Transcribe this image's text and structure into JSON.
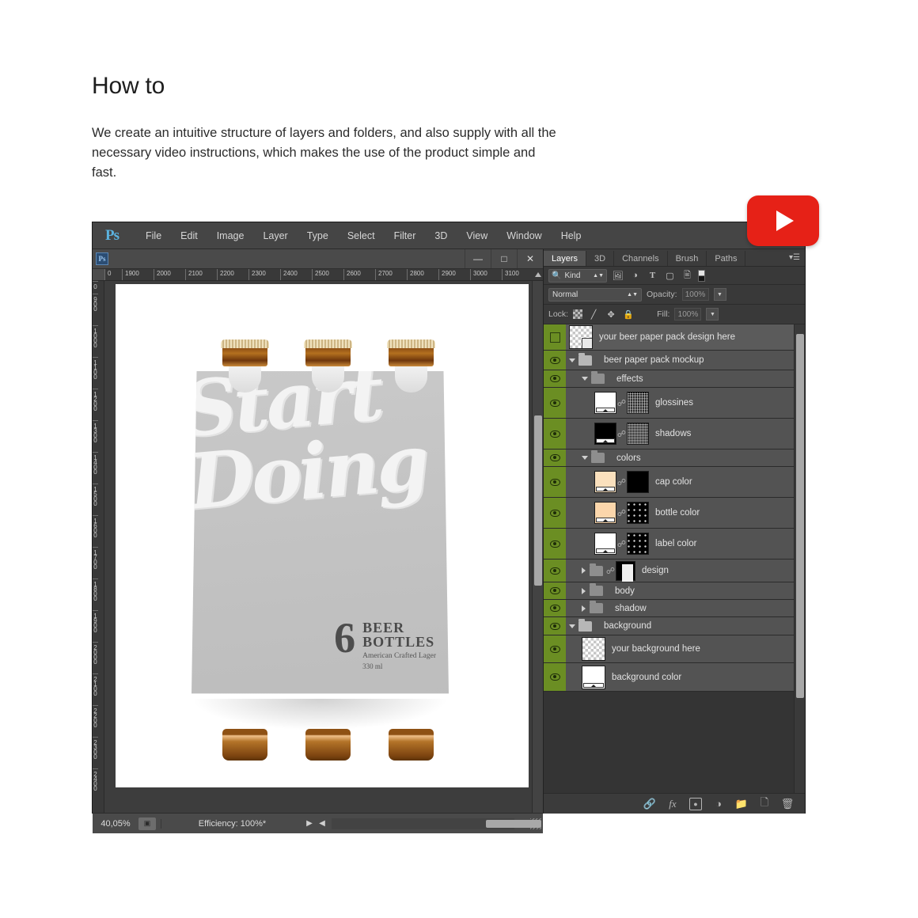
{
  "article": {
    "title": "How to",
    "body": "We create an intuitive structure of layers and folders, and also supply with all the necessary video instructions, which makes the use of the product simple and fast."
  },
  "youtube_badge": {
    "name": "youtube-play-badge",
    "color": "#e62117"
  },
  "photoshop": {
    "app_logo": "Ps",
    "menu": [
      "File",
      "Edit",
      "Image",
      "Layer",
      "Type",
      "Select",
      "Filter",
      "3D",
      "View",
      "Window",
      "Help"
    ],
    "document_window": {
      "icon_label": "Ps",
      "window_buttons": {
        "minimize": "—",
        "maximize": "□",
        "close": "✕"
      },
      "ruler_top_ticks": [
        "0",
        "1900",
        "2000",
        "2100",
        "2200",
        "2300",
        "2400",
        "2500",
        "2600",
        "2700",
        "2800",
        "2900",
        "3000",
        "3100"
      ],
      "ruler_left_ticks": [
        "0",
        "900",
        "1000",
        "1100",
        "1200",
        "1300",
        "1400",
        "1500",
        "1600",
        "1700",
        "1800",
        "1900",
        "2000",
        "2100",
        "2200",
        "2300",
        "2400"
      ],
      "canvas_origin_label": "0",
      "status": {
        "zoom": "40,05%",
        "efficiency": "Efficiency: 100%*"
      }
    },
    "mockup": {
      "script_line1": "Start",
      "script_line2": "Doing",
      "count": "6",
      "title_line1": "BEER",
      "title_line2": "BOTTLES",
      "subtitle": "American Crafted Lager",
      "volume": "330 ml"
    },
    "panel": {
      "tabs": [
        {
          "label": "Layers",
          "active": true
        },
        {
          "label": "3D",
          "active": false
        },
        {
          "label": "Channels",
          "active": false
        },
        {
          "label": "Brush",
          "active": false
        },
        {
          "label": "Paths",
          "active": false
        }
      ],
      "filter": {
        "kind_label": "Kind",
        "icons": [
          "pixel-filter-icon",
          "adjustment-filter-icon",
          "type-filter-icon",
          "shape-filter-icon",
          "smartobject-filter-icon",
          "mask-filter-icon"
        ]
      },
      "blend": {
        "mode": "Normal",
        "opacity_label": "Opacity:",
        "opacity_value": "100%"
      },
      "lock": {
        "label": "Lock:",
        "icons": [
          "lock-transparency-icon",
          "lock-image-icon",
          "lock-position-icon",
          "lock-all-icon"
        ],
        "fill_label": "Fill:",
        "fill_value": "100%"
      },
      "layers": [
        {
          "name": "your beer paper pack design here",
          "type": "smart-object",
          "indent": 0,
          "visible": false,
          "selected": true,
          "thumb": "checker"
        },
        {
          "name": "beer paper pack mockup",
          "type": "group",
          "indent": 0,
          "visible": true,
          "expanded": true
        },
        {
          "name": "effects",
          "type": "group",
          "indent": 1,
          "visible": true,
          "expanded": true
        },
        {
          "name": "glossines",
          "type": "adjustment",
          "indent": 2,
          "visible": true,
          "thumb": "white-gradient",
          "mask": "noise"
        },
        {
          "name": "shadows",
          "type": "adjustment",
          "indent": 2,
          "visible": true,
          "thumb": "black-gradient",
          "mask": "noise"
        },
        {
          "name": "colors",
          "type": "group",
          "indent": 1,
          "visible": true,
          "expanded": true
        },
        {
          "name": "cap color",
          "type": "adjustment",
          "indent": 2,
          "visible": true,
          "thumb": "cream-gradient",
          "mask": "black"
        },
        {
          "name": "bottle color",
          "type": "adjustment",
          "indent": 2,
          "visible": true,
          "thumb": "peach-gradient",
          "mask": "dots"
        },
        {
          "name": "label color",
          "type": "adjustment",
          "indent": 2,
          "visible": true,
          "thumb": "white-gradient",
          "mask": "dots"
        },
        {
          "name": "design",
          "type": "group",
          "indent": 1,
          "visible": true,
          "expanded": false,
          "mask": "design"
        },
        {
          "name": "body",
          "type": "group",
          "indent": 1,
          "visible": true,
          "expanded": false
        },
        {
          "name": "shadow",
          "type": "group",
          "indent": 1,
          "visible": true,
          "expanded": false
        },
        {
          "name": "background",
          "type": "group",
          "indent": 0,
          "visible": true,
          "expanded": true
        },
        {
          "name": "your background here",
          "type": "raster",
          "indent": 1,
          "visible": true,
          "thumb": "checker"
        },
        {
          "name": "background color",
          "type": "adjustment",
          "indent": 1,
          "visible": true,
          "thumb": "white-gradient"
        }
      ],
      "footer_icons": [
        "link-layers-icon",
        "layer-styles-icon",
        "add-mask-icon",
        "adjustment-layer-icon",
        "new-group-icon",
        "new-layer-icon",
        "delete-layer-icon"
      ]
    }
  }
}
